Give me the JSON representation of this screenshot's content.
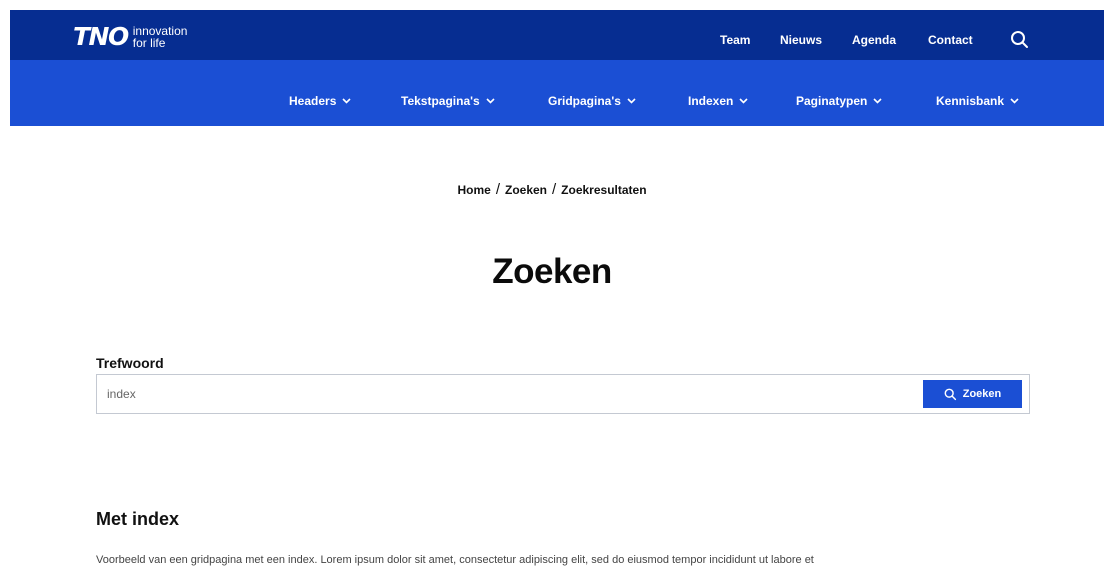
{
  "brand": {
    "logo": "TNO",
    "tagline_line1": "innovation",
    "tagline_line2": "for life"
  },
  "util_nav": [
    "Team",
    "Nieuws",
    "Agenda",
    "Contact"
  ],
  "main_nav": [
    "Headers",
    "Tekstpagina's",
    "Gridpagina's",
    "Indexen",
    "Paginatypen",
    "Kennisbank"
  ],
  "breadcrumb": [
    "Home",
    "Zoeken",
    "Zoekresultaten"
  ],
  "page_title": "Zoeken",
  "search": {
    "label": "Trefwoord",
    "value": "index",
    "button_label": "Zoeken"
  },
  "results": [
    {
      "title": "Met index",
      "description": "Voorbeeld van een gridpagina met een index. Lorem ipsum dolor sit amet, consectetur adipiscing elit, sed do eiusmod tempor incididunt ut labore et"
    }
  ],
  "colors": {
    "top_bar": "#062d91",
    "sub_bar": "#1b4fd4",
    "button": "#1b4fd4"
  },
  "icons": {
    "search": "search-icon",
    "dropdown": "chevron-down-icon"
  }
}
